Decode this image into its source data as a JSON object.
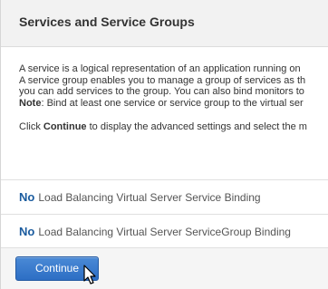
{
  "header": {
    "title": "Services and Service Groups"
  },
  "description": {
    "line1": "A service is a logical representation of an application running on",
    "line2": "A service group enables you to manage a group of services as th",
    "line3": "you can add services to the group. You can also bind monitors to",
    "line4_label": "Note",
    "line4_text": ": Bind at least one service or service group to the virtual ser",
    "line5_prefix": "Click ",
    "line5_bold": "Continue",
    "line5_suffix": " to display the advanced settings and select the m"
  },
  "bindings": [
    {
      "status": "No",
      "label": "Load Balancing Virtual Server Service Binding"
    },
    {
      "status": "No",
      "label": "Load Balancing Virtual Server ServiceGroup Binding"
    }
  ],
  "footer": {
    "continue_label": "Continue"
  },
  "colors": {
    "accent": "#1a5b9e",
    "button": "#2d6ec4"
  }
}
